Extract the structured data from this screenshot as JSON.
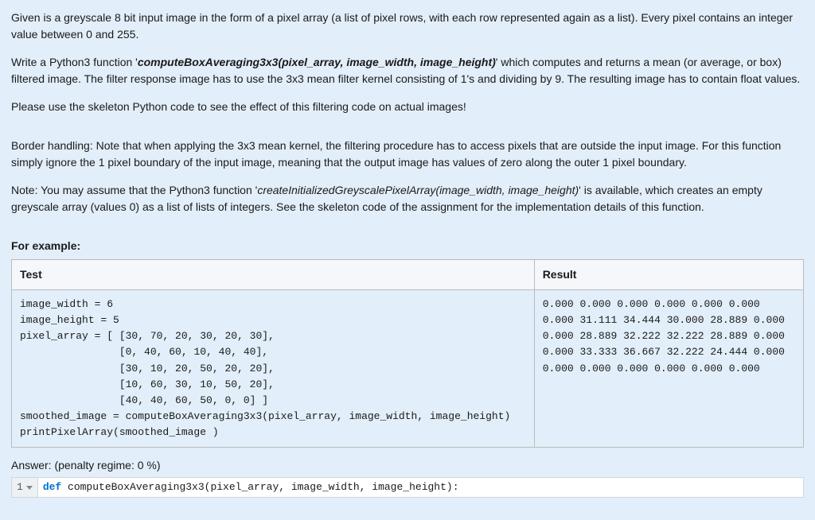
{
  "intro": {
    "p1": "Given is a greyscale 8 bit input image in the form of a pixel array (a list of pixel rows, with each row represented again as a list). Every pixel contains an integer value between 0 and 255.",
    "p2_a": "Write a Python3 function '",
    "p2_func": "computeBoxAveraging3x3(pixel_array, image_width, image_height)",
    "p2_b": "' which computes and returns a mean (or average, or box) filtered image. The filter response image has to use the 3x3 mean filter kernel consisting of 1's and dividing by 9. The resulting image has to contain float values.",
    "p3": "Please use the skeleton Python code to see the effect of this filtering code on actual images!",
    "p4": "Border handling: Note that when applying the 3x3 mean kernel, the filtering procedure has to access pixels that are outside the input image. For this function simply ignore the 1 pixel boundary of the input image, meaning that the output image has values of zero along the outer 1 pixel boundary.",
    "p5_a": "Note: You may assume that the Python3 function '",
    "p5_func": "createInitializedGreyscalePixelArray(image_width, image_height)",
    "p5_b": "' is available, which creates an empty greyscale array (values 0) as a list of lists of integers. See the skeleton code of the assignment for the implementation details of this function."
  },
  "example": {
    "label": "For example:",
    "th_test": "Test",
    "th_result": "Result",
    "test_code": "image_width = 6\nimage_height = 5\npixel_array = [ [30, 70, 20, 30, 20, 30],\n                [0, 40, 60, 10, 40, 40],\n                [30, 10, 20, 50, 20, 20],\n                [10, 60, 30, 10, 50, 20],\n                [40, 40, 60, 50, 0, 0] ]\nsmoothed_image = computeBoxAveraging3x3(pixel_array, image_width, image_height)\nprintPixelArray(smoothed_image )",
    "result_text": "0.000 0.000 0.000 0.000 0.000 0.000\n0.000 31.111 34.444 30.000 28.889 0.000\n0.000 28.889 32.222 32.222 28.889 0.000\n0.000 33.333 36.667 32.222 24.444 0.000\n0.000 0.000 0.000 0.000 0.000 0.000"
  },
  "answer": {
    "label_prefix": "Answer: ",
    "penalty": "(penalty regime: 0 %)",
    "line_number": "1",
    "code_kw": "def",
    "code_rest": " computeBoxAveraging3x3(pixel_array, image_width, image_height):"
  }
}
